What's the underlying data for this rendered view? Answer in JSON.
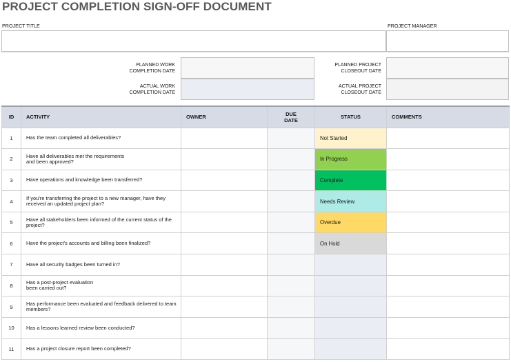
{
  "document": {
    "title": "PROJECT COMPLETION SIGN-OFF DOCUMENT",
    "project_title_label": "PROJECT TITLE",
    "project_title_value": "",
    "project_manager_label": "PROJECT MANAGER",
    "project_manager_value": "",
    "planned_work_completion_label_1": "PLANNED WORK",
    "planned_work_completion_label_2": "COMPLETION DATE",
    "actual_work_completion_label_1": "ACTUAL WORK",
    "actual_work_completion_label_2": "COMPLETION DATE",
    "planned_closeout_label_1": "PLANNED PROJECT",
    "planned_closeout_label_2": "CLOSEOUT DATE",
    "actual_closeout_label_1": "ACTUAL PROJECT",
    "actual_closeout_label_2": "CLOSEOUT DATE"
  },
  "table": {
    "headers": {
      "id": "ID",
      "activity": "ACTIVITY",
      "owner": "OWNER",
      "due_1": "DUE",
      "due_2": "DATE",
      "status": "STATUS",
      "comments": "COMMENTS"
    },
    "rows": [
      {
        "id": "1",
        "activity_1": "Has the team completed all deliverables?",
        "activity_2": "",
        "owner": "",
        "due": "",
        "status": "Not Started",
        "status_color": "#fff2cc",
        "comments": ""
      },
      {
        "id": "2",
        "activity_1": "Have all deliverables met the requirements",
        "activity_2": "and been approved?",
        "owner": "",
        "due": "",
        "status": "In Progress",
        "status_color": "#92d050",
        "comments": ""
      },
      {
        "id": "3",
        "activity_1": "Have operations and knowledge been transferred?",
        "activity_2": "",
        "owner": "",
        "due": "",
        "status": "Complete",
        "status_color": "#00c060",
        "comments": ""
      },
      {
        "id": "4",
        "activity_1": "If you're transferring the project to a new manager, have they",
        "activity_2": "received an updated project plan?",
        "owner": "",
        "due": "",
        "status": "Needs Review",
        "status_color": "#aeeae6",
        "comments": ""
      },
      {
        "id": "5",
        "activity_1": "Have all stakeholders been informed of the current status of the",
        "activity_2": "project?",
        "owner": "",
        "due": "",
        "status": "Overdue",
        "status_color": "#ffd966",
        "comments": ""
      },
      {
        "id": "6",
        "activity_1": "Have the project's accounts and billing been finalized?",
        "activity_2": "",
        "owner": "",
        "due": "",
        "status": "On Hold",
        "status_color": "#d9d9d9",
        "comments": ""
      },
      {
        "id": "7",
        "activity_1": "Have all security badges been turned in?",
        "activity_2": "",
        "owner": "",
        "due": "",
        "status": "",
        "status_color": "#eaedf3",
        "comments": ""
      },
      {
        "id": "8",
        "activity_1": "Has a post-project evaluation",
        "activity_2": "been carried out?",
        "owner": "",
        "due": "",
        "status": "",
        "status_color": "#eaedf3",
        "comments": ""
      },
      {
        "id": "9",
        "activity_1": "Has performance been evaluated and feedback delivered to team",
        "activity_2": "members?",
        "owner": "",
        "due": "",
        "status": "",
        "status_color": "#eaedf3",
        "comments": ""
      },
      {
        "id": "10",
        "activity_1": "Has a lessons learned review been conducted?",
        "activity_2": "",
        "owner": "",
        "due": "",
        "status": "",
        "status_color": "#eaedf3",
        "comments": ""
      },
      {
        "id": "11",
        "activity_1": "Has a project closure report been completed?",
        "activity_2": "",
        "owner": "",
        "due": "",
        "status": "",
        "status_color": "#eaedf3",
        "comments": ""
      }
    ]
  }
}
